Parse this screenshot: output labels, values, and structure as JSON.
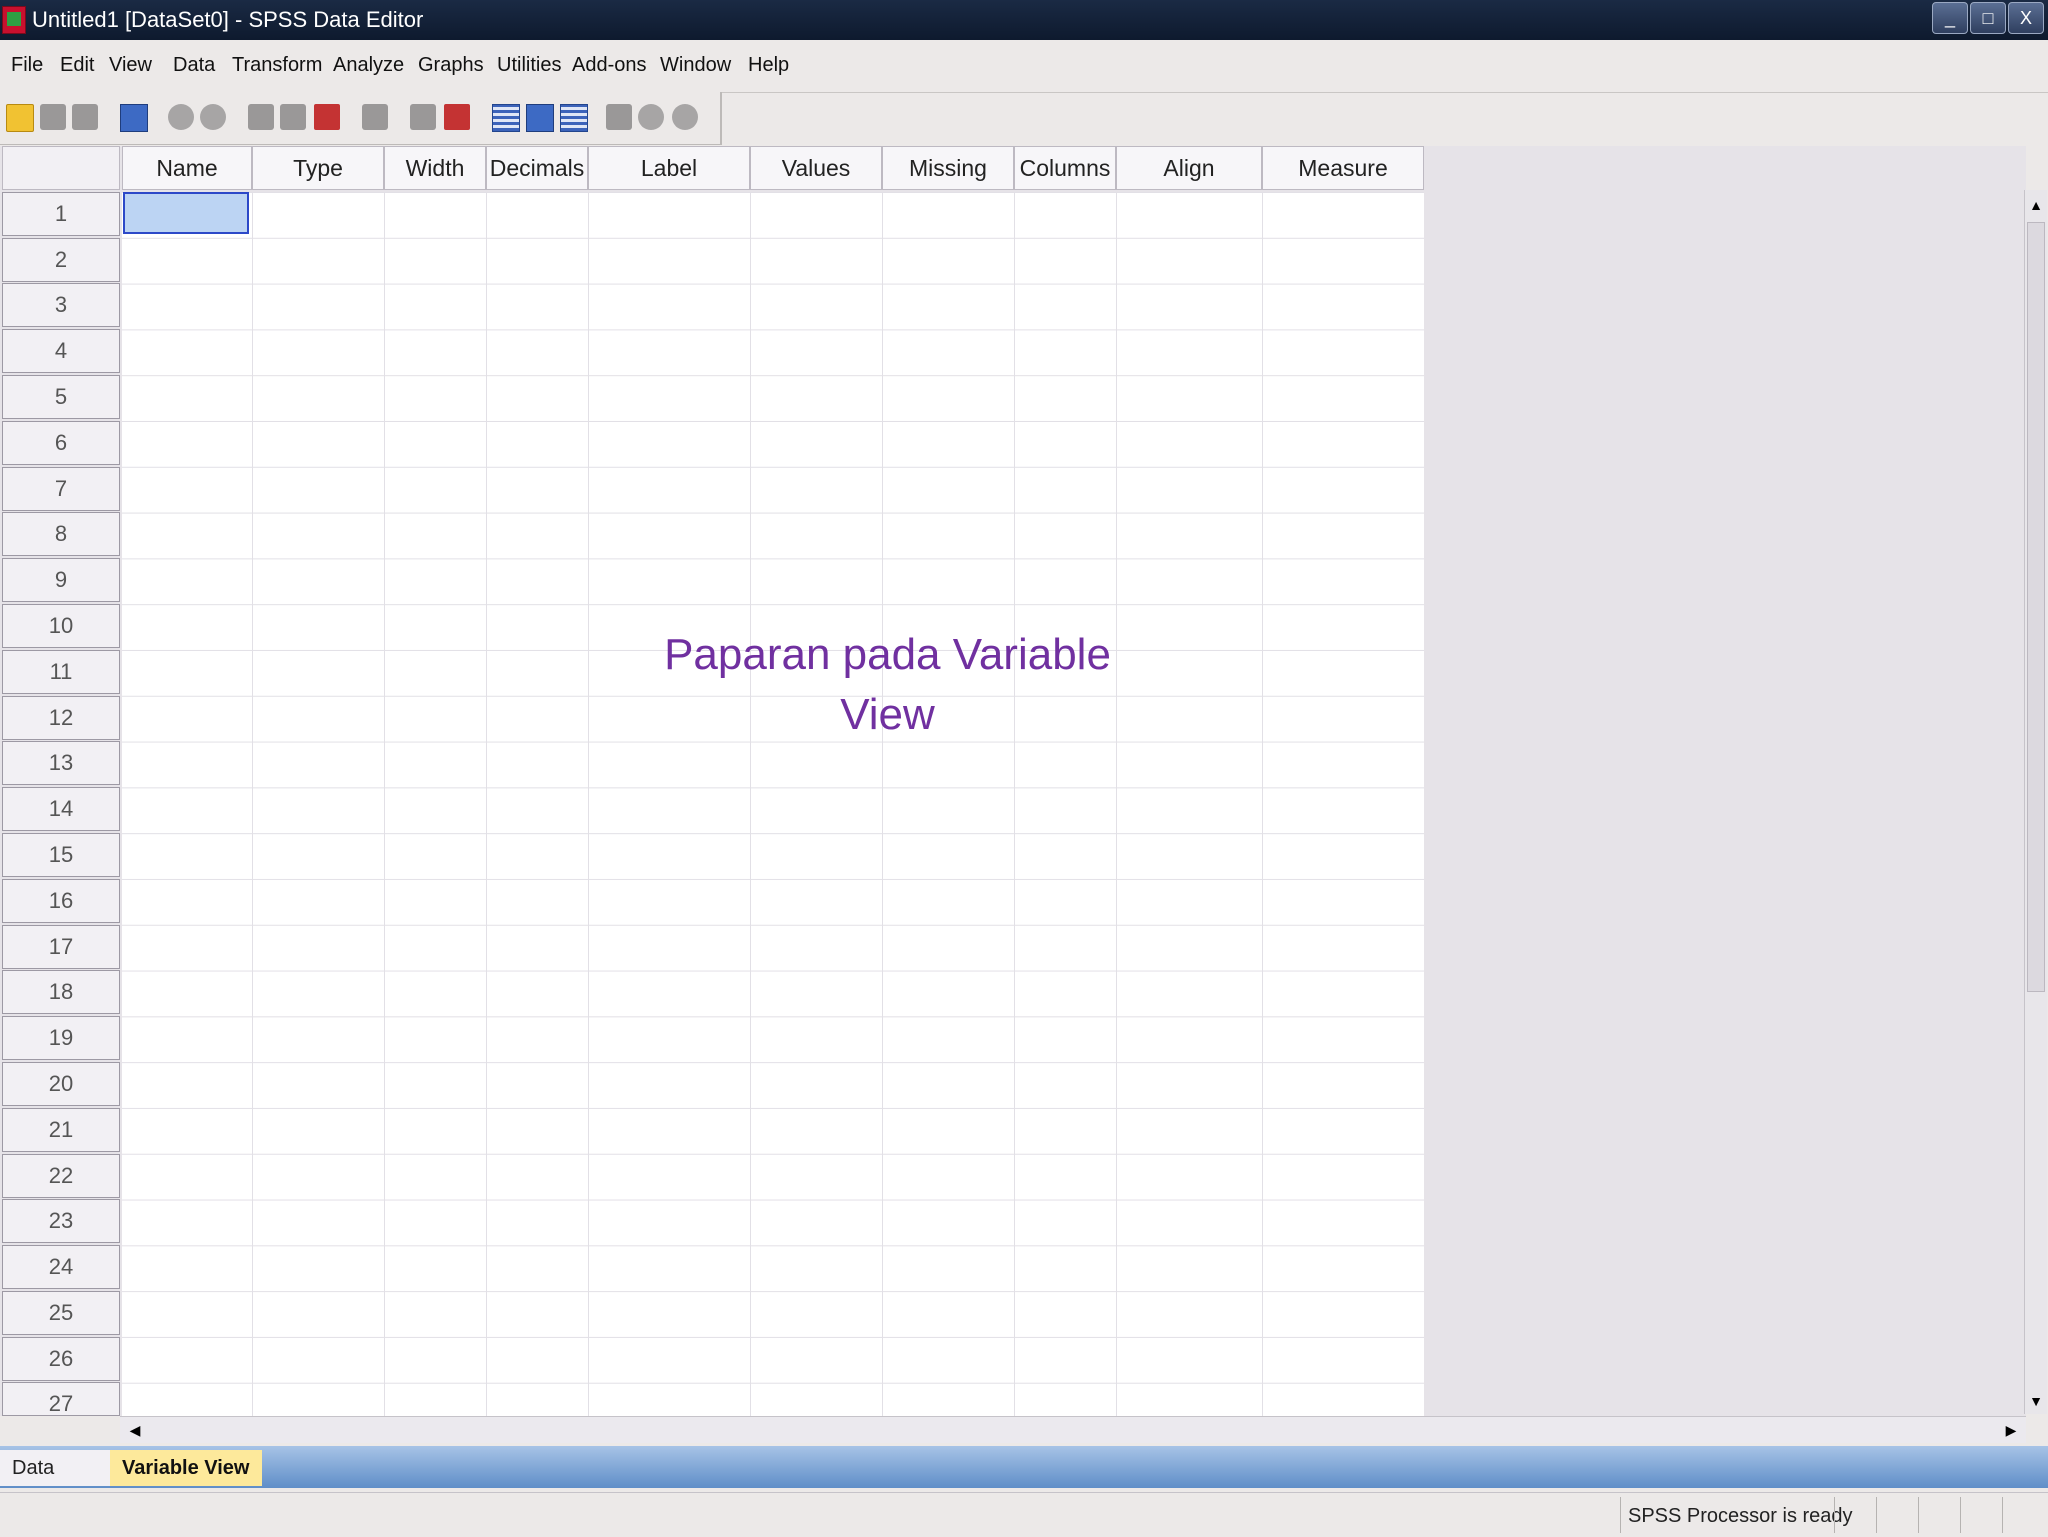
{
  "window": {
    "title": "Untitled1 [DataSet0] - SPSS Data Editor",
    "controls": [
      "_",
      "□",
      "X"
    ]
  },
  "menu": [
    "File",
    "Edit",
    "View",
    "Data",
    "Transform",
    "Analyze",
    "Graphs",
    "Utilities",
    "Add-ons",
    "Window",
    "Help"
  ],
  "toolbar": {
    "icons": [
      "open-icon",
      "save-icon",
      "print-icon",
      "dialog-recall-icon",
      "undo-icon",
      "redo-icon",
      "goto-case-icon",
      "goto-variable-icon",
      "variables-icon",
      "find-icon",
      "insert-cases-icon",
      "insert-variable-icon",
      "split-file-icon",
      "weight-cases-icon",
      "select-cases-icon",
      "value-labels-icon",
      "use-sets-icon",
      "show-all-icon"
    ]
  },
  "grid": {
    "columns": [
      "Name",
      "Type",
      "Width",
      "Decimals",
      "Label",
      "Values",
      "Missing",
      "Columns",
      "Align",
      "Measure"
    ],
    "rows": [
      "1",
      "2",
      "3",
      "4",
      "5",
      "6",
      "7",
      "8",
      "9",
      "10",
      "11",
      "12",
      "13",
      "14",
      "15",
      "16",
      "17",
      "18",
      "19",
      "20",
      "21",
      "22",
      "23",
      "24",
      "25",
      "26",
      "27"
    ],
    "selected_row": "1",
    "selected_column": "Name"
  },
  "overlay": {
    "line1": "Paparan pada Variable",
    "line2": "View",
    "color": "#7030a0"
  },
  "tabs": {
    "data_view": "Data View",
    "variable_view": "Variable View",
    "active": "Variable View"
  },
  "status": {
    "text": "SPSS  Processor is ready"
  },
  "scroll": {
    "up": "▲",
    "down": "▼",
    "left": "◀",
    "right": "▶"
  }
}
